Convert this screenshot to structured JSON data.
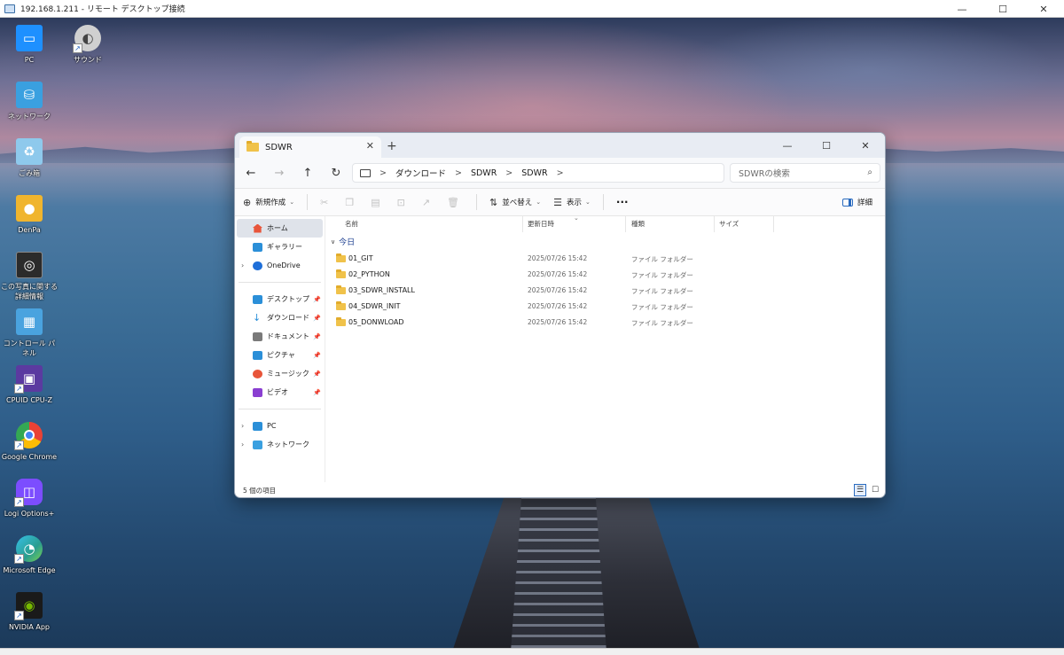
{
  "rdp": {
    "title": "192.168.1.211 - リモート デスクトップ接続",
    "minimize": "—",
    "maximize": "☐",
    "close": "✕"
  },
  "desktop_icons": [
    {
      "label": "PC",
      "icon": "pc-icon",
      "color": "#1e90ff"
    },
    {
      "label": "サウンド",
      "icon": "sound-icon",
      "color": "#d0d0d0"
    },
    {
      "label": "ネットワーク",
      "icon": "network-icon",
      "color": "#3aa0e0"
    },
    {
      "label": "ごみ箱",
      "icon": "recycle-bin-icon",
      "color": "#8ec9ec"
    },
    {
      "label": "DenPa",
      "icon": "folder-user-icon",
      "color": "#f0b52e"
    },
    {
      "label": "この写真に関する詳細情報",
      "icon": "camera-icon",
      "color": "#2b2b2b"
    },
    {
      "label": "コントロール パネル",
      "icon": "control-panel-icon",
      "color": "#4aa3df"
    },
    {
      "label": "CPUID CPU-Z",
      "icon": "cpuz-icon",
      "color": "#5b3aa0"
    },
    {
      "label": "Google Chrome",
      "icon": "chrome-icon",
      "color": "#e94235"
    },
    {
      "label": "Logi Options+",
      "icon": "logi-icon",
      "color": "#7c4dff"
    },
    {
      "label": "Microsoft Edge",
      "icon": "edge-icon",
      "color": "#2a9d8f"
    },
    {
      "label": "NVIDIA App",
      "icon": "nvidia-icon",
      "color": "#76b900"
    }
  ],
  "explorer": {
    "tab_title": "SDWR",
    "tab_close": "✕",
    "new_tab": "+",
    "window_controls": {
      "minimize": "—",
      "maximize": "☐",
      "close": "✕"
    },
    "nav": {
      "back": "←",
      "forward": "→",
      "up": "↑",
      "refresh": "↻"
    },
    "breadcrumb": [
      "ダウンロード",
      "SDWR",
      "SDWR"
    ],
    "breadcrumb_sep": ">",
    "search_placeholder": "SDWRの検索",
    "toolbar": {
      "new": "新規作成",
      "sort": "並べ替え",
      "view": "表示",
      "more": "···",
      "details": "詳細"
    },
    "sidebar": {
      "home": "ホーム",
      "gallery": "ギャラリー",
      "onedrive": "OneDrive",
      "quick": [
        {
          "label": "デスクトップ",
          "color": "#2b8fd8"
        },
        {
          "label": "ダウンロード",
          "color": "#2b8fd8"
        },
        {
          "label": "ドキュメント",
          "color": "#7a7a7a"
        },
        {
          "label": "ピクチャ",
          "color": "#2b8fd8"
        },
        {
          "label": "ミュージック",
          "color": "#e8553a"
        },
        {
          "label": "ビデオ",
          "color": "#8a3fd1"
        }
      ],
      "pc": "PC",
      "network": "ネットワーク"
    },
    "columns": {
      "name": "名前",
      "date": "更新日時",
      "type": "種類",
      "size": "サイズ"
    },
    "group": "今日",
    "files": [
      {
        "name": "01_GIT",
        "date": "2025/07/26 15:42",
        "type": "ファイル フォルダー"
      },
      {
        "name": "02_PYTHON",
        "date": "2025/07/26 15:42",
        "type": "ファイル フォルダー"
      },
      {
        "name": "03_SDWR_INSTALL",
        "date": "2025/07/26 15:42",
        "type": "ファイル フォルダー"
      },
      {
        "name": "04_SDWR_INIT",
        "date": "2025/07/26 15:42",
        "type": "ファイル フォルダー"
      },
      {
        "name": "05_DONWLOAD",
        "date": "2025/07/26 15:42",
        "type": "ファイル フォルダー"
      }
    ],
    "status": "5 個の項目"
  }
}
